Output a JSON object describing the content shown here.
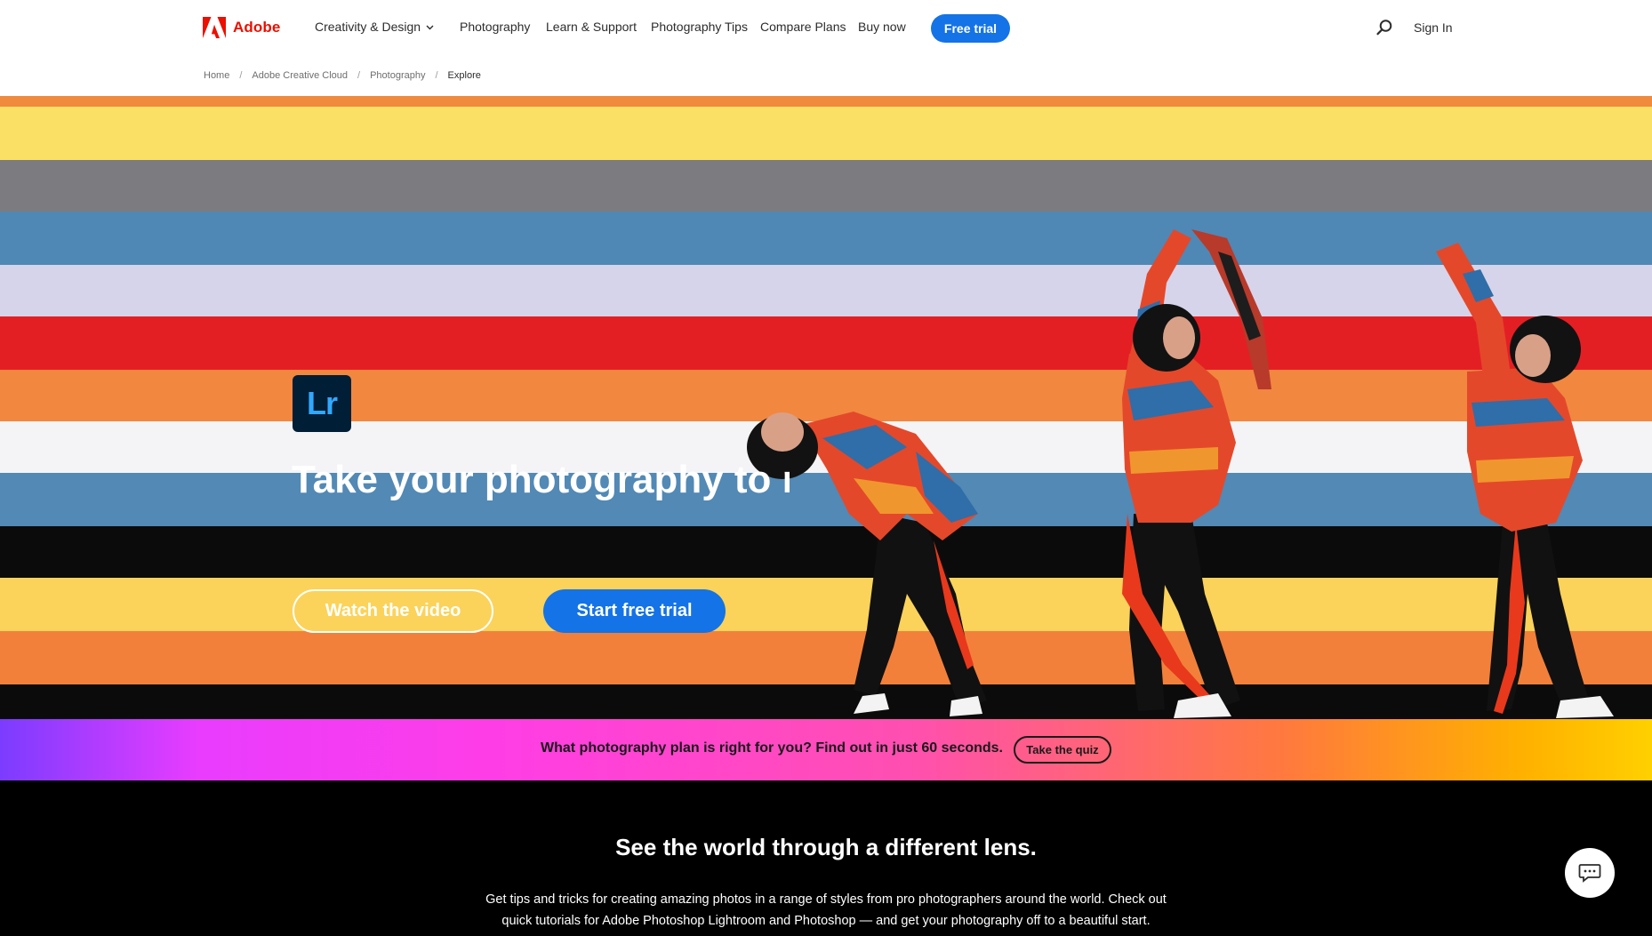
{
  "brand": {
    "name": "Adobe",
    "color": "#eb1000"
  },
  "nav": {
    "items": [
      {
        "label": "Creativity & Design",
        "has_dropdown": true
      },
      {
        "label": "Photography"
      },
      {
        "label": "Learn & Support"
      },
      {
        "label": "Photography Tips"
      },
      {
        "label": "Compare Plans"
      },
      {
        "label": "Buy now"
      }
    ],
    "cta_label": "Free trial",
    "search_icon": "search-icon",
    "signin_label": "Sign In"
  },
  "breadcrumb": [
    "Home",
    "Adobe Creative Cloud",
    "Photography",
    "Explore"
  ],
  "hero": {
    "app_badge": "Lr",
    "title": "Take your photography to new heights.",
    "watch_label": "Watch the video",
    "start_label": "Start free trial",
    "accent": "#1473e6"
  },
  "quiz": {
    "text": "What photography plan is right for you? Find out in just 60 seconds.",
    "button_label": "Take the quiz"
  },
  "lens": {
    "title": "See the world through a different lens.",
    "body": "Get tips and tricks for creating amazing photos in a range of styles from pro photographers around the world. Check out quick tutorials for Adobe Photoshop Lightroom and Photoshop — and get your photography off to a beautiful start."
  },
  "chat": {
    "icon": "chat-icon"
  }
}
